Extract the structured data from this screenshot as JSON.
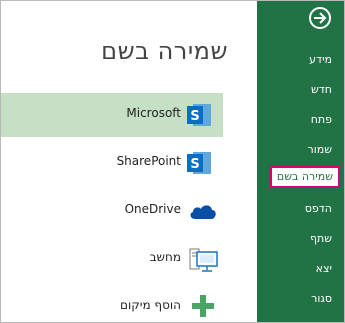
{
  "nav": {
    "back": "back-arrow-icon",
    "items": [
      "מידע",
      "חדש",
      "פתח",
      "שמור",
      "שמירה בשם",
      "הדפס",
      "שתף",
      "יצא",
      "סגור"
    ],
    "selected_index": 4
  },
  "main": {
    "title": "שמירה בשם",
    "locations": [
      {
        "label": "Microsoft",
        "icon": "sharepoint-icon",
        "selected": true
      },
      {
        "label": "SharePoint",
        "icon": "sharepoint-icon",
        "selected": false
      },
      {
        "label": "OneDrive",
        "icon": "cloud-icon",
        "selected": false
      },
      {
        "label": "מחשב",
        "icon": "computer-icon",
        "selected": false
      },
      {
        "label": "הוסף מיקום",
        "icon": "plus-icon",
        "selected": false
      }
    ]
  },
  "colors": {
    "nav_bg": "#217346",
    "selected_row_bg": "#c6e0c6",
    "highlight_border": "#d6007a",
    "sharepoint_blue": "#0a6fc4",
    "onedrive_blue": "#0a4fa6",
    "add_green": "#4aa564"
  }
}
